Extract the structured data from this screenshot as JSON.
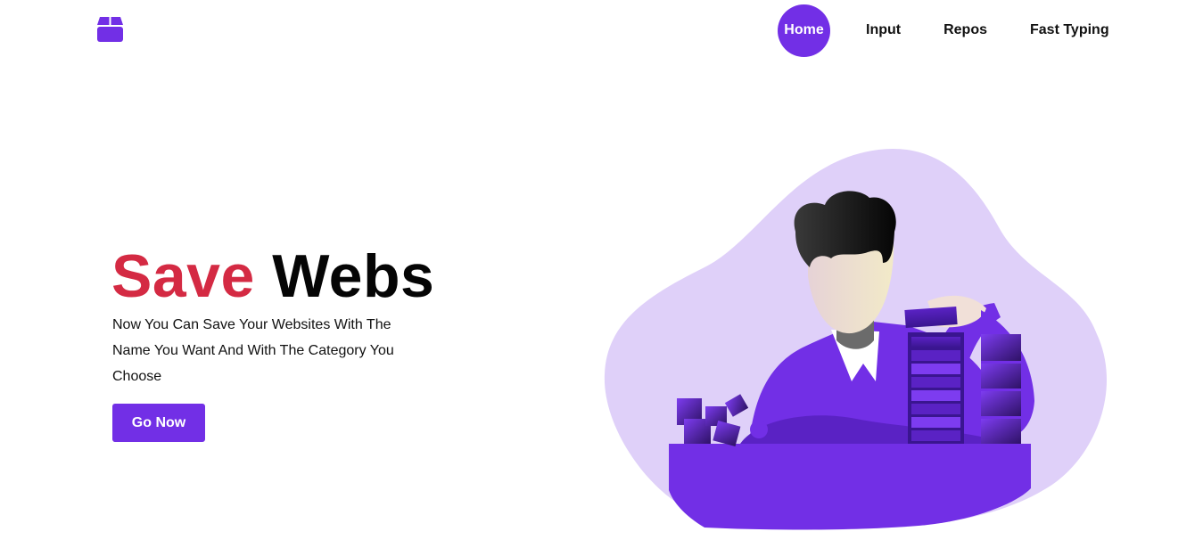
{
  "brand": {
    "icon": "box-icon",
    "accent": "#722FE6"
  },
  "nav": {
    "items": [
      {
        "label": "Home",
        "active": true
      },
      {
        "label": "Input"
      },
      {
        "label": "Repos"
      },
      {
        "label": "Fast Typing"
      }
    ]
  },
  "hero": {
    "title_red": "Save",
    "title_dark": "Webs",
    "description": "Now You Can Save Your Websites With The Name You Want And With The Category You Choose",
    "cta_label": "Go Now",
    "title_red_color": "#D42A43"
  },
  "illustration": {
    "icon": "man-stacking-blocks-illustration"
  }
}
